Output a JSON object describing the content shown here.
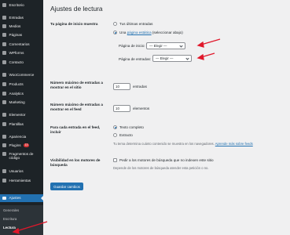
{
  "sidebar": {
    "items": [
      {
        "label": "Escritorio",
        "icon": "dashboard-icon"
      },
      {
        "label": "Entradas",
        "icon": "pin-icon"
      },
      {
        "label": "Medios",
        "icon": "media-icon"
      },
      {
        "label": "Páginas",
        "icon": "page-icon"
      },
      {
        "label": "Comentarios",
        "icon": "comment-icon"
      },
      {
        "label": "WPforms",
        "icon": "wpforms-icon"
      },
      {
        "label": "Contacto",
        "icon": "mail-icon"
      },
      {
        "label": "WooCommerce",
        "icon": "woocommerce-icon"
      },
      {
        "label": "Products",
        "icon": "products-icon"
      },
      {
        "label": "Analytics",
        "icon": "analytics-icon"
      },
      {
        "label": "Marketing",
        "icon": "megaphone-icon"
      },
      {
        "label": "Elementor",
        "icon": "elementor-icon"
      },
      {
        "label": "Plantillas",
        "icon": "templates-icon"
      },
      {
        "label": "Apariencia",
        "icon": "brush-icon"
      },
      {
        "label": "Plugins",
        "icon": "plugin-icon",
        "badge": "13"
      },
      {
        "label": "Fragmentos de código",
        "icon": "code-icon"
      },
      {
        "label": "Usuarios",
        "icon": "users-icon"
      },
      {
        "label": "Herramientas",
        "icon": "tools-icon"
      },
      {
        "label": "Ajustes",
        "icon": "settings-icon"
      }
    ],
    "submenu": [
      "Generales",
      "Escritura",
      "Lectura"
    ]
  },
  "page": {
    "title": "Ajustes de lectura",
    "homepage": {
      "label": "Tu página de inicio muestra",
      "option_latest": "Tus últimas entradas",
      "option_static_prefix": "Una",
      "option_static_link": "página estática",
      "option_static_suffix": "(seleccionar abajo)",
      "front_label": "Página de inicio:",
      "front_value": "— Elegir —",
      "posts_label": "Página de entradas:",
      "posts_value": "— Elegir —"
    },
    "posts_per_page": {
      "label": "Número máximo de entradas a mostrar en el sitio",
      "value": "10",
      "unit": "entradas"
    },
    "posts_per_rss": {
      "label": "Número máximo de entradas a mostrar en el feed",
      "value": "10",
      "unit": "elementos"
    },
    "feed_content": {
      "label": "Para cada entrada en el feed, incluir",
      "option_full": "Texto completo",
      "option_excerpt": "Extracto",
      "desc_prefix": "Tu tema determina cuánto contenido se muestra en los navegadores.",
      "desc_link": "Aprende más sobre feeds"
    },
    "visibility": {
      "label": "Visibilidad en los motores de búsqueda",
      "checkbox_label": "Pedir a los motores de búsqueda que no indexen este sitio",
      "desc": "Depende de los motores de búsqueda atender esta petición o no."
    },
    "save_label": "Guardar cambios"
  },
  "colors": {
    "accent": "#2271b1",
    "arrow": "#e0182b",
    "sidebar": "#1d2327"
  }
}
